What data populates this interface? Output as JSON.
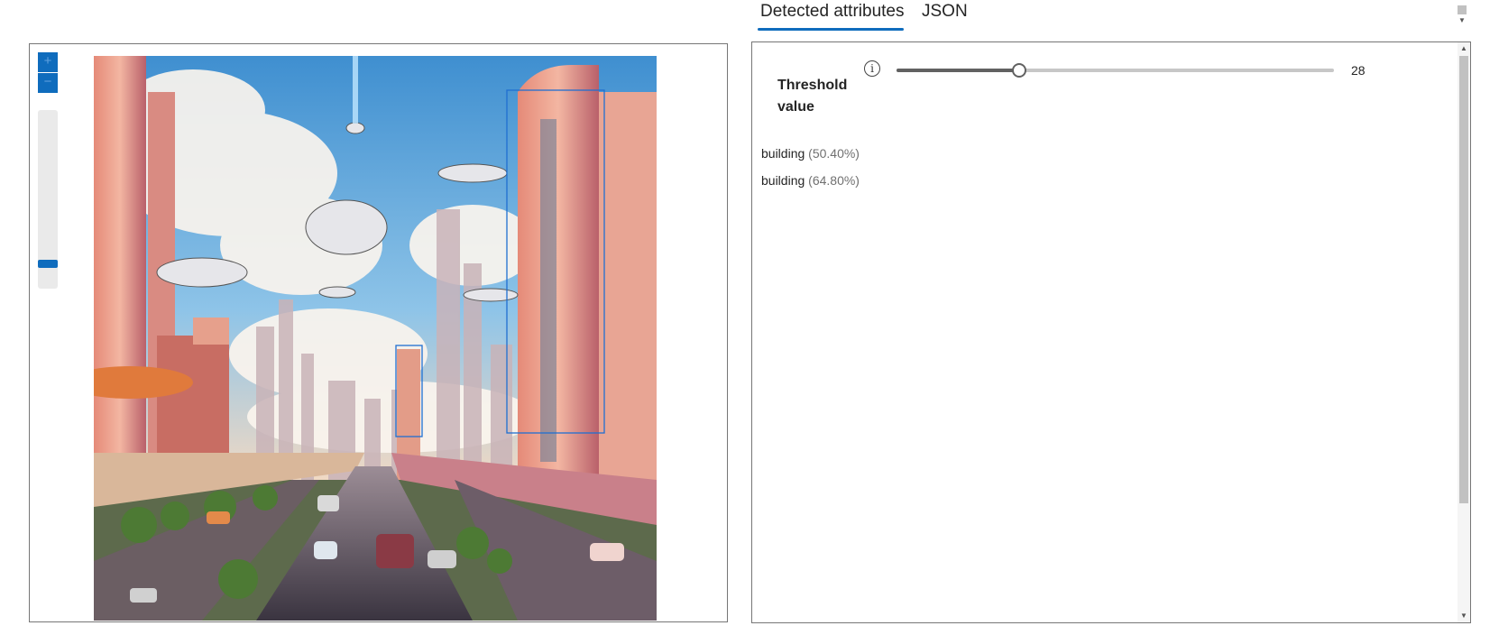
{
  "tabs": [
    {
      "label": "Detected attributes",
      "active": true
    },
    {
      "label": "JSON",
      "active": false
    }
  ],
  "viewer": {
    "zoom_in_symbol": "+",
    "zoom_out_symbol": "−",
    "zoom_level_fraction": 0.88,
    "image_description": "futuristic city with flying vehicles and highway"
  },
  "threshold": {
    "label": "Threshold value",
    "value": "28",
    "min": 0,
    "max": 100,
    "info_icon": "info-icon"
  },
  "detections": [
    {
      "label": "building",
      "confidence": "(50.40%)"
    },
    {
      "label": "building",
      "confidence": "(64.80%)"
    }
  ],
  "colors": {
    "accent": "#0f6cbd",
    "bounding_box": "#1f6fd1",
    "slider": "#616161"
  }
}
